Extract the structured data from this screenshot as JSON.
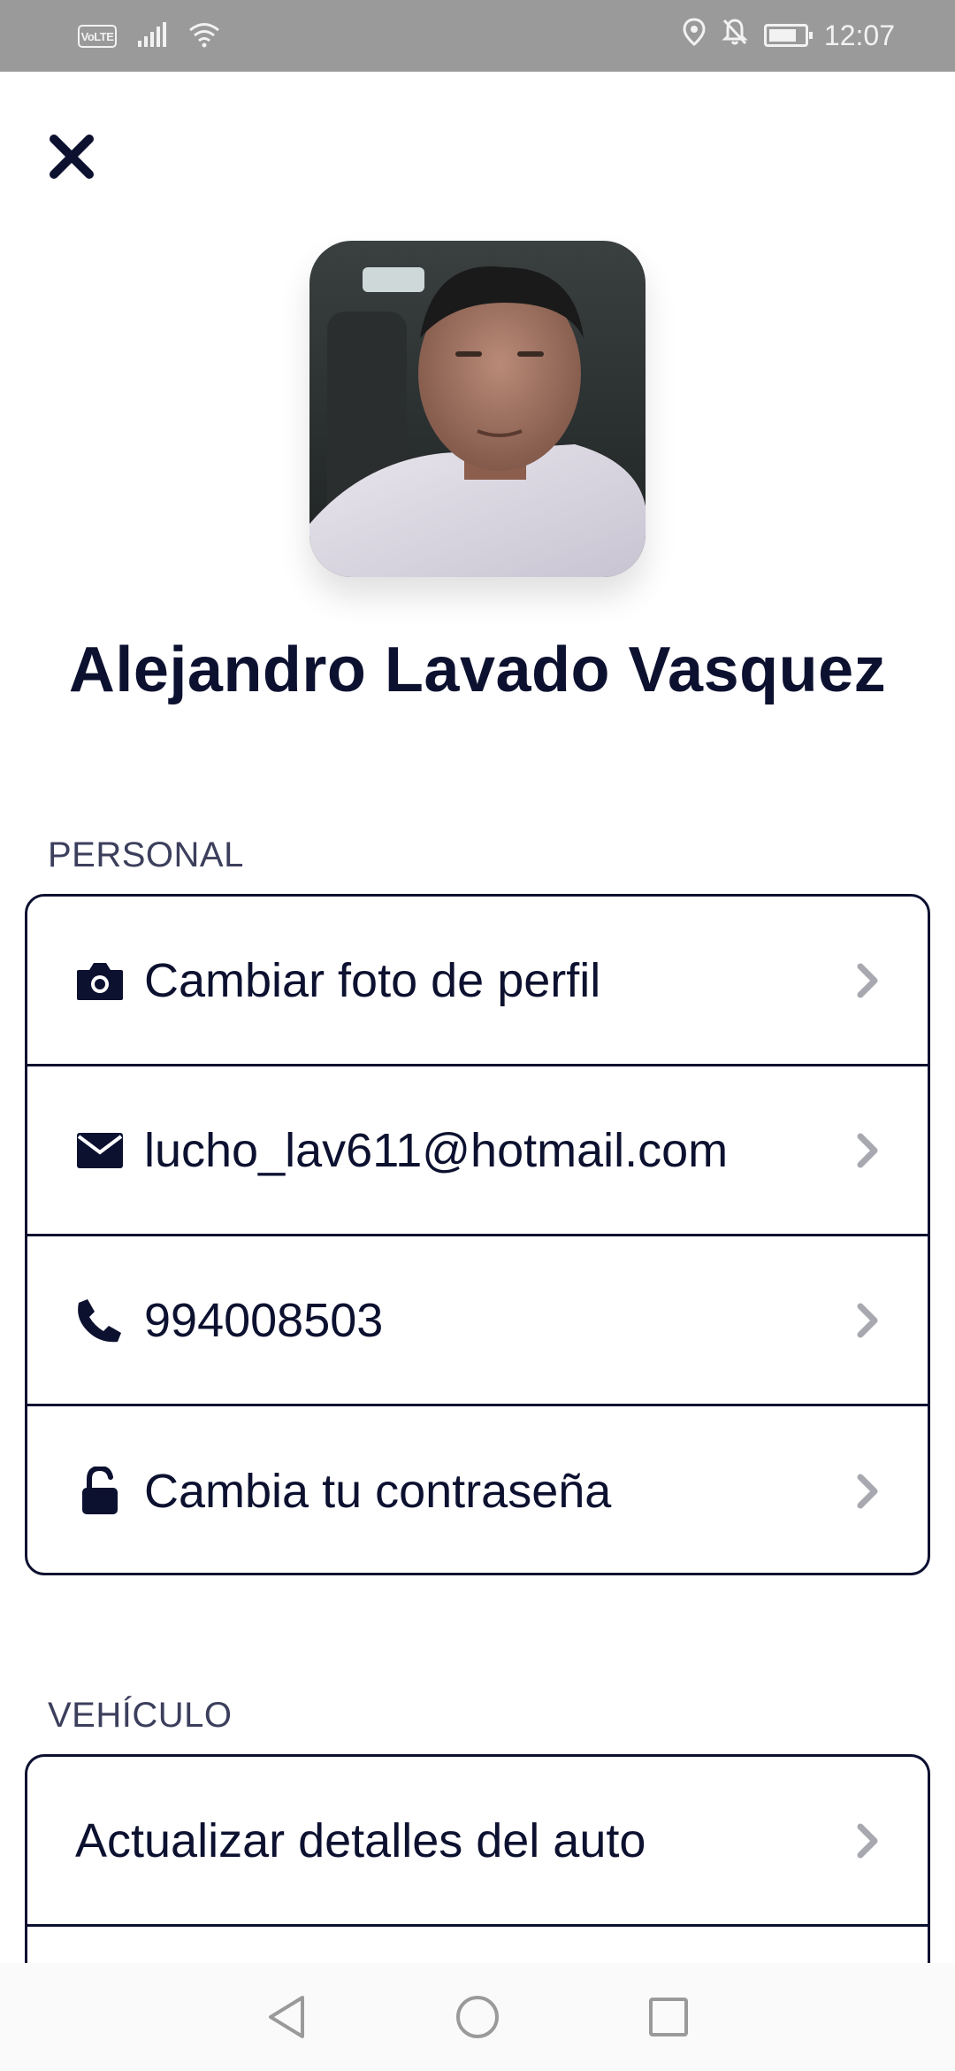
{
  "status_bar": {
    "network_badge": "VoLTE",
    "time": "12:07",
    "icons": [
      "signal-icon",
      "wifi-icon",
      "location-icon",
      "notifications-off-icon",
      "battery-icon"
    ]
  },
  "profile": {
    "name": "Alejandro Lavado Vasquez"
  },
  "personal": {
    "section_label": "PERSONAL",
    "items": [
      {
        "label": "Cambiar foto de perfil",
        "icon": "camera-icon"
      },
      {
        "label": "lucho_lav611@hotmail.com",
        "icon": "mail-icon"
      },
      {
        "label": "994008503",
        "icon": "phone-icon"
      },
      {
        "label": "Cambia tu contraseña",
        "icon": "lock-icon"
      }
    ]
  },
  "vehicle": {
    "section_label": "VEHÍCULO",
    "items": [
      {
        "label": "Actualizar detalles del auto"
      }
    ]
  },
  "colors": {
    "primary": "#0d1130",
    "chevron": "#a8a8b0",
    "status_bar": "#9a9a9a"
  }
}
